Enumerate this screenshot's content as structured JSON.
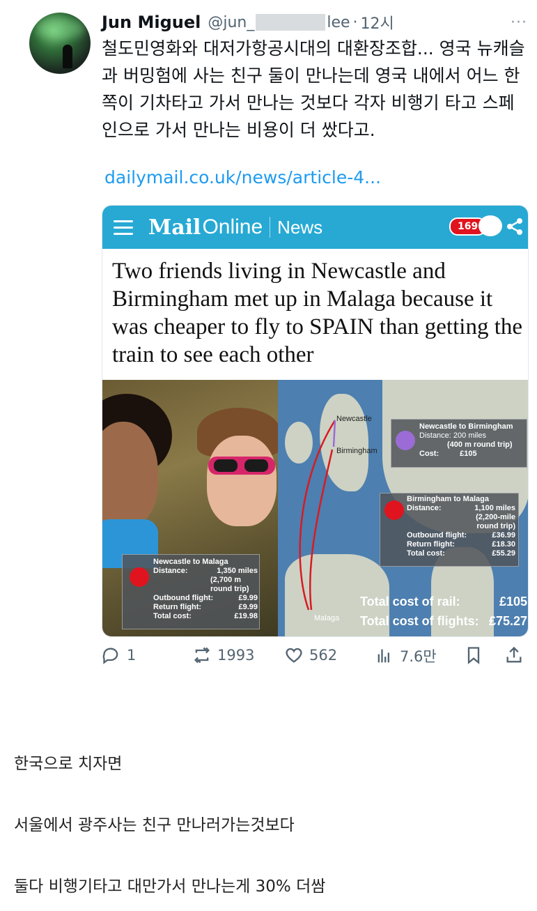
{
  "tweet": {
    "author_name": "Jun Miguel",
    "handle_prefix": "@jun_",
    "handle_suffix": "lee",
    "separator": "·",
    "time": "12시",
    "more": "···",
    "text": "철도민영화와 대저가항공시대의 대환장조합... 영국 뉴캐슬과 버밍험에 사는 친구 둘이 만나는데 영국 내에서 어느 한 쪽이 기차타고 가서 만나는 것보다 각자 비행기 타고 스페인으로 가서 만나는 비용이 더 쌌다고.",
    "link": "dailymail.co.uk/news/article-4..."
  },
  "card": {
    "site_logo": "Mail",
    "site_logo_suffix": "Online",
    "section": "News",
    "comment_count": "169",
    "headline": "Two friends living in Newcastle and Birmingham met up in Malaga because it was cheaper to fly to SPAIN than getting the train to see each other",
    "map": {
      "city_newcastle": "Newcastle",
      "city_birmingham": "Birmingham",
      "city_malaga": "Malaga",
      "box1_title": "Newcastle to Birmingham",
      "box1_l1": "Distance: 200 miles",
      "box1_l2": "(400 m round trip)",
      "box1_l3": "Cost:",
      "box1_l3v": "£105",
      "box2_title": "Birmingham to Malaga",
      "box2_l1": "Distance:",
      "box2_l1v": "1,100 miles",
      "box2_l2": "(2,200-mile",
      "box2_l3": "round trip)",
      "box2_l4": "Outbound flight:",
      "box2_l4v": "£36.99",
      "box2_l5": "Return flight:",
      "box2_l5v": "£18.30",
      "box2_l6": "Total cost:",
      "box2_l6v": "£55.29",
      "box3_title": "Newcastle to Malaga",
      "box3_l1": "Distance:",
      "box3_l1v": "1,350 miles",
      "box3_l2": "(2,700 m",
      "box3_l3": "round trip)",
      "box3_l4": "Outbound flight:",
      "box3_l4v": "£9.99",
      "box3_l5": "Return flight:",
      "box3_l5v": "£9.99",
      "box3_l6": "Total cost:",
      "box3_l6v": "£19.98",
      "total_rail_label": "Total cost of rail:",
      "total_rail_value": "£105",
      "total_flights_label": "Total cost of flights:",
      "total_flights_value": "£75.27"
    }
  },
  "actions": {
    "replies": "1",
    "retweets": "1993",
    "likes": "562",
    "views": "7.6만"
  },
  "comments": [
    "한국으로 치자면",
    "서울에서 광주사는 친구 만나러가는것보다",
    "둘다 비행기타고 대만가서 만나는게 30% 더쌈"
  ],
  "colors": {
    "link": "#1d9bf0",
    "mail_bar": "#27a9d4",
    "badge": "#e0141e",
    "muted": "#536471"
  }
}
